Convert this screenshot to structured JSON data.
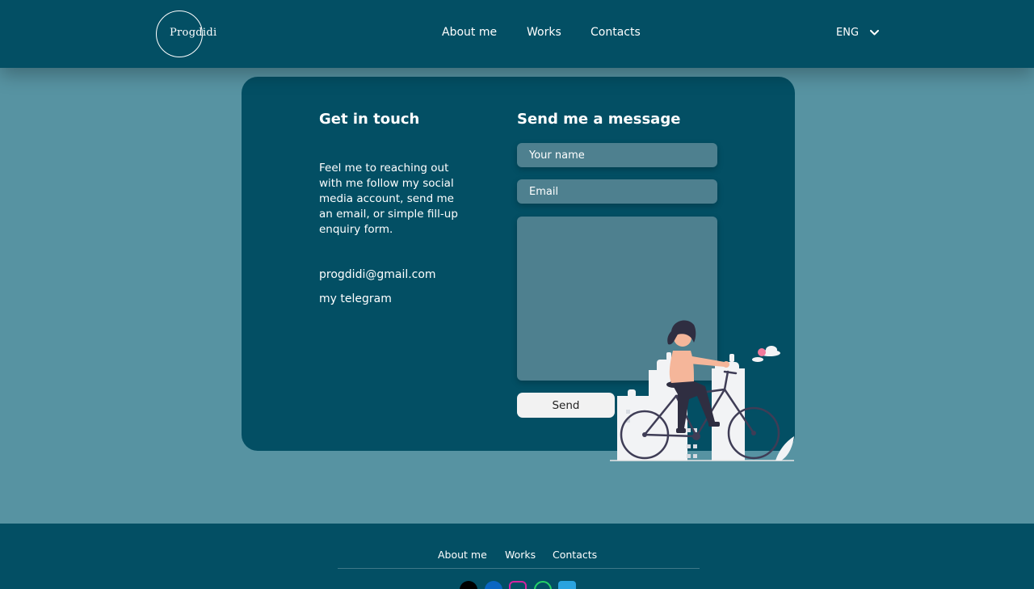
{
  "header": {
    "logo_text": "Progdidi",
    "nav": [
      "About me",
      "Works",
      "Contacts"
    ],
    "language": "ENG"
  },
  "contact": {
    "title": "Get in touch",
    "description": "Feel me to reaching out with me follow my social media account, send me an email, or simple fill-up enquiry form.",
    "email": "progdidi@gmail.com",
    "telegram": "my telegram"
  },
  "form": {
    "title": "Send me a message",
    "name_placeholder": "Your name",
    "email_placeholder": "Email",
    "send_label": "Send"
  },
  "footer": {
    "nav": [
      "About me",
      "Works",
      "Contacts"
    ],
    "social_icons": [
      "email-icon",
      "linkedin-icon",
      "instagram-icon",
      "whatsapp-icon",
      "telegram-icon"
    ]
  },
  "colors": {
    "header_bg": "#034f64",
    "page_bg": "#5793a2",
    "field_bg": "#4e808f",
    "button_bg": "#f2f2f2",
    "accent_pink": "#f27a9c"
  }
}
